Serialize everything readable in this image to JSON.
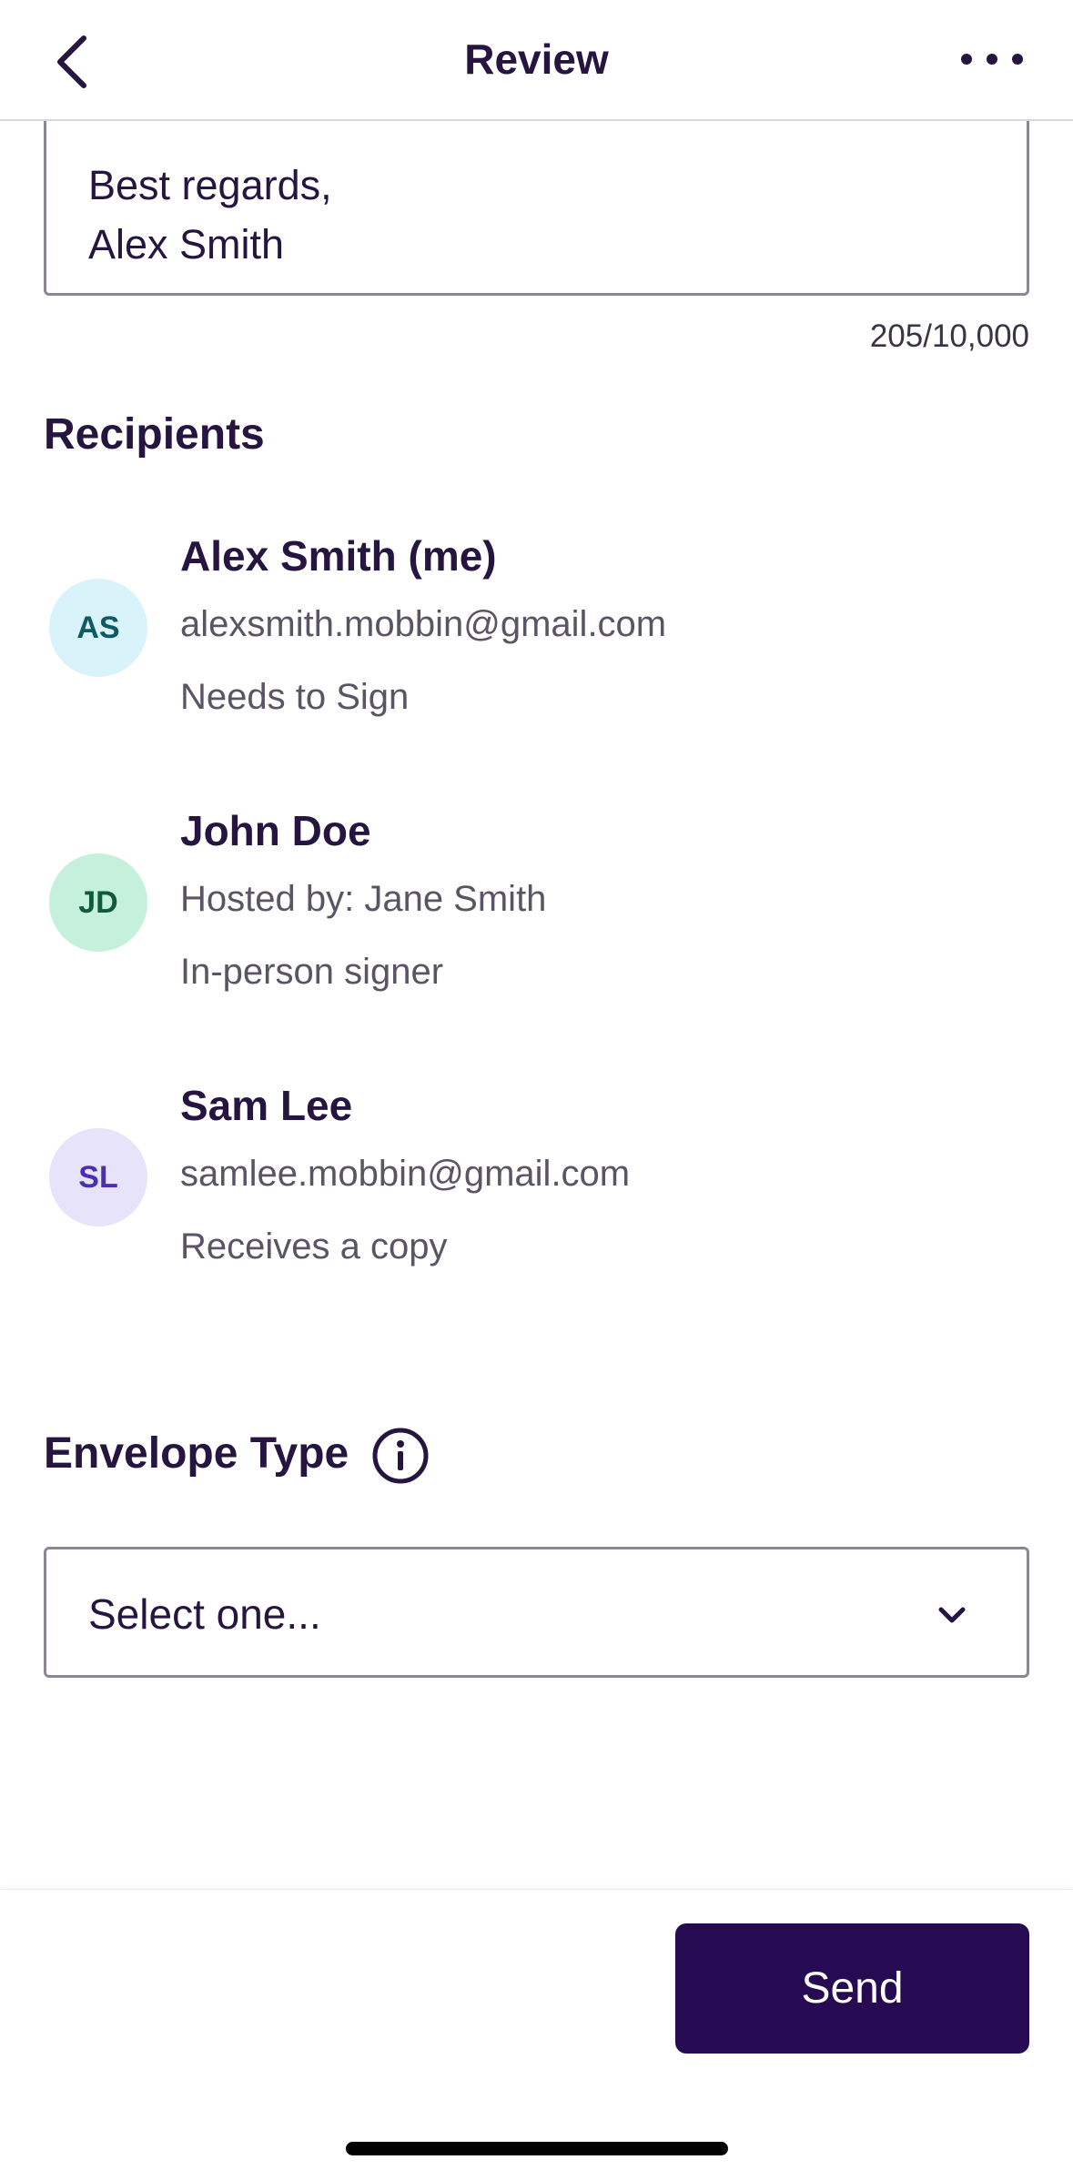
{
  "header": {
    "title": "Review",
    "back_icon": "chevron-left-icon",
    "more_icon": "more-horizontal-icon"
  },
  "message": {
    "lines": [
      "Best regards,",
      "Alex Smith"
    ],
    "char_count": "205/10,000"
  },
  "recipients": {
    "title": "Recipients",
    "items": [
      {
        "initials": "AS",
        "name": "Alex Smith (me)",
        "detail": "alexsmith.mobbin@gmail.com",
        "role": "Needs to Sign",
        "avatar_bg": "#d9f3fb",
        "avatar_fg": "#0d5a63"
      },
      {
        "initials": "JD",
        "name": "John Doe",
        "detail": "Hosted by: Jane Smith",
        "role": "In-person signer",
        "avatar_bg": "#c5f1dc",
        "avatar_fg": "#0f5a3a"
      },
      {
        "initials": "SL",
        "name": "Sam Lee",
        "detail": "samlee.mobbin@gmail.com",
        "role": "Receives a copy",
        "avatar_bg": "#e7e3fb",
        "avatar_fg": "#4a2fb0"
      }
    ]
  },
  "envelope_type": {
    "title": "Envelope Type",
    "info_icon": "info-icon",
    "select_value": "Select one...",
    "chevron_icon": "chevron-down-icon"
  },
  "footer": {
    "send_label": "Send"
  },
  "colors": {
    "primary": "#260a52",
    "text": "#261540",
    "muted": "#5a5464",
    "border": "#8c8694"
  }
}
